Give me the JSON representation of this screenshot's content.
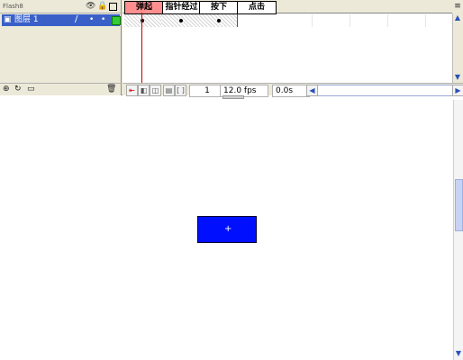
{
  "layers_panel": {
    "title": "Flash8",
    "header_icons": [
      "eye-icon",
      "lock-icon",
      "outline-icon"
    ],
    "layer": {
      "name": "图层 1",
      "visible_dot": "•",
      "lock_dot": "•",
      "outline_color": "#33cc33",
      "pencil": "/"
    },
    "footer_icons": [
      "insert-layer-icon",
      "add-motion-guide-icon",
      "insert-folder-icon",
      "trash-icon"
    ]
  },
  "frame_headers": [
    {
      "label": "弹起",
      "active": true
    },
    {
      "label": "指针经过",
      "active": false
    },
    {
      "label": "按下",
      "active": false
    },
    {
      "label": "点击",
      "active": false
    }
  ],
  "frame_footer": {
    "current_frame": "1",
    "frame_rate": "12.0 fps",
    "elapsed": "0.0s"
  },
  "stage": {
    "button_symbol_fill": "#0010ff",
    "registration_mark": "+"
  },
  "window": {
    "menu_glyph": "≡"
  }
}
